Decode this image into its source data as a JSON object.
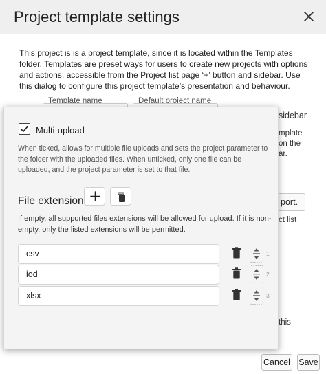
{
  "dialog": {
    "title": "Project template settings",
    "intro": "This project is is a project template, since it is located within the Templates folder. Templates are preset ways for users to create new projects with options and actions, accessible from the Project list page ‘+’ button and sidebar. Use this dialog to configure this project template’s presentation and behaviour."
  },
  "background": {
    "template_name_label": "Template name",
    "default_project_name_label": "Default project name",
    "sidebar_frag": "sidebar",
    "template_frag": "mplate",
    "on_the_frag": "on the",
    "bar_frag": "ar.",
    "port_frag": "port.",
    "ct_list_frag": "ct list",
    "this_frag": "this"
  },
  "footer": {
    "cancel_label": "Cancel",
    "save_label": "Save"
  },
  "popup": {
    "checkbox_label": "Multi-upload",
    "checkbox_checked": true,
    "checkbox_help": "When ticked, allows for multiple file uploads and sets the project parameter to the folder with the uploaded files. When unticked, only one file can be uploaded, and the project parameter is set to that file.",
    "file_extensions_title": "File extensions",
    "extensions_help": "If empty, all supported files extensions will be allowed for upload. If it is non-empty, only the listed extensions will be permitted.",
    "extensions": [
      {
        "value": "csv",
        "index": "1"
      },
      {
        "value": "iod",
        "index": "2"
      },
      {
        "value": "xlsx",
        "index": "3"
      }
    ]
  }
}
